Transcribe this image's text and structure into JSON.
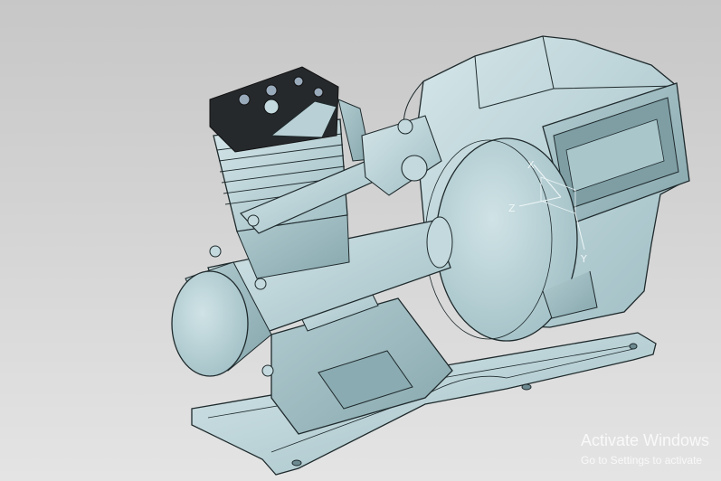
{
  "viewport": {
    "background_top": "#c7c7c7",
    "background_bottom": "#e4e4e4",
    "model_color": "#b9d1d6",
    "model_shadow": "#8fb0b6",
    "edge_color": "#1f2a2c",
    "head_color": "#26292c"
  },
  "triad": {
    "x_label": "X",
    "y_label": "Y",
    "z_label": "Z"
  },
  "watermark": {
    "line1": "Activate Windows",
    "line2": "Go to Settings to activate"
  }
}
